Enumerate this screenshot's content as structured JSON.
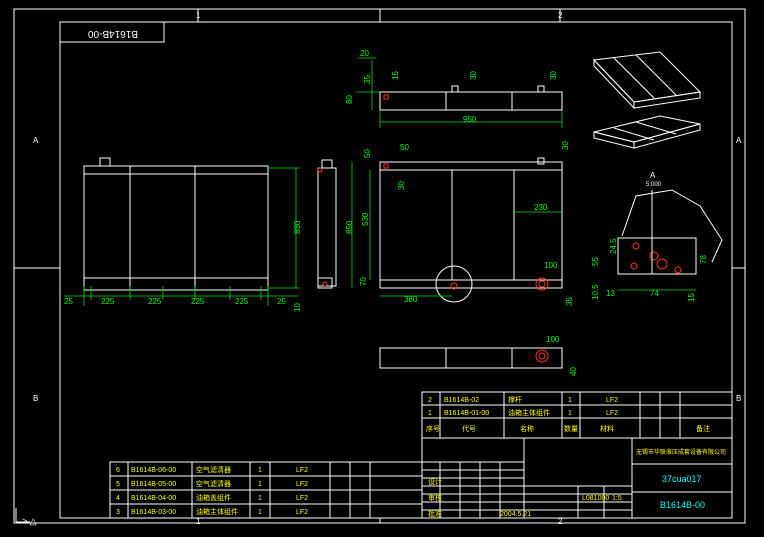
{
  "frame": {
    "zones_top": [
      "1",
      "2"
    ],
    "zones_bottom": [
      "1",
      "2"
    ],
    "zones_left": [
      "A",
      "B"
    ],
    "zones_right": [
      "A",
      "B"
    ]
  },
  "drawing_number_box": "B1614B-00",
  "front_view": {
    "height": "830",
    "bottom_dims": [
      "25",
      "225",
      "225",
      "225",
      "225",
      "25"
    ],
    "right_small": "10"
  },
  "side_view": {
    "height_850": "850",
    "height_530": "530",
    "offset_70": "70"
  },
  "top_view": {
    "d20": "20",
    "d35": "35",
    "d15": "15",
    "d30": "30",
    "d80": "80",
    "d950": "950"
  },
  "main_view": {
    "d50a": "50",
    "d50b": "50",
    "d30a": "30",
    "d30b": "30",
    "d230": "230",
    "d100": "100",
    "d380": "380",
    "d35": "35"
  },
  "bottom_view": {
    "d100": "100",
    "d40": "40"
  },
  "detail_view": {
    "label": "A",
    "scale": "5:000",
    "d245": "24.5",
    "d55": "55",
    "d78": "78",
    "d105": "10.5",
    "d13": "13",
    "d74": "74",
    "d15": "15"
  },
  "parts_table": [
    {
      "no": "2",
      "code": "B1614B-02",
      "name": "撑杆",
      "qty": "1",
      "mat": "LF2"
    },
    {
      "no": "1",
      "code": "B1614B-01-00",
      "name": "油箱主体组件",
      "qty": "1",
      "mat": "LF2"
    }
  ],
  "parts_header": [
    "序号",
    "代号",
    "名称",
    "数量",
    "材料",
    "",
    "备注"
  ],
  "left_table": [
    {
      "no": "6",
      "code": "B1614B-06-00",
      "name": "空气滤清器",
      "qty": "1",
      "mat": "LF2"
    },
    {
      "no": "5",
      "code": "B1614B-05-00",
      "name": "空气滤清器",
      "qty": "1",
      "mat": "LF2"
    },
    {
      "no": "4",
      "code": "B1614B-04-00",
      "name": "油箱盖组件",
      "qty": "1",
      "mat": "LF2"
    },
    {
      "no": "3",
      "code": "B1614B-03-00",
      "name": "油箱主体组件",
      "qty": "1",
      "mat": "LF2"
    }
  ],
  "title_block": {
    "company": "无锡市华联液压成套设备有限公司",
    "product": "37cua017",
    "drawing_no": "B1614B-00",
    "ratio": "1:5",
    "sheet": "1:1",
    "weight": "L081000",
    "date": "2004.5.21",
    "designer": "设计",
    "checker": "审核",
    "approver": "批准"
  },
  "command": "> △"
}
